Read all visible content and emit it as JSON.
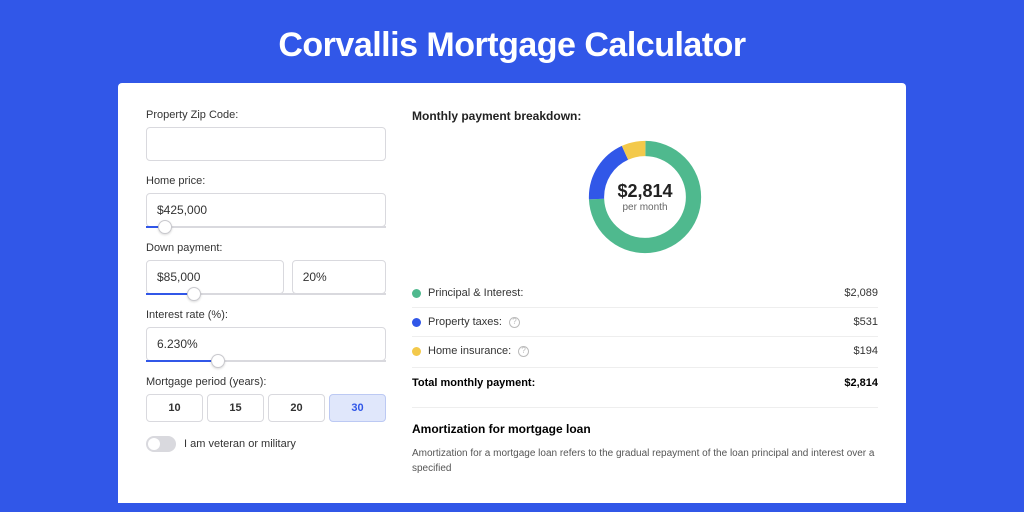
{
  "title": "Corvallis Mortgage Calculator",
  "colors": {
    "principal": "#4fb98e",
    "taxes": "#3157e8",
    "insurance": "#f3c94b"
  },
  "form": {
    "zip_label": "Property Zip Code:",
    "zip_value": "",
    "price_label": "Home price:",
    "price_value": "$425,000",
    "price_slider_pct": 8,
    "down_label": "Down payment:",
    "down_amount": "$85,000",
    "down_pct": "20%",
    "down_slider_pct": 20,
    "rate_label": "Interest rate (%):",
    "rate_value": "6.230%",
    "rate_slider_pct": 30,
    "period_label": "Mortgage period (years):",
    "periods": [
      "10",
      "15",
      "20",
      "30"
    ],
    "period_active": "30",
    "veteran_label": "I am veteran or military"
  },
  "breakdown": {
    "section_label": "Monthly payment breakdown:",
    "center_amount": "$2,814",
    "center_sub": "per month",
    "rows": [
      {
        "label": "Principal & Interest:",
        "value": "$2,089",
        "color": "principal",
        "info": false
      },
      {
        "label": "Property taxes:",
        "value": "$531",
        "color": "taxes",
        "info": true
      },
      {
        "label": "Home insurance:",
        "value": "$194",
        "color": "insurance",
        "info": true
      }
    ],
    "total_label": "Total monthly payment:",
    "total_value": "$2,814"
  },
  "chart_data": {
    "type": "pie",
    "title": "Monthly payment breakdown",
    "series": [
      {
        "name": "Principal & Interest",
        "value": 2089
      },
      {
        "name": "Property taxes",
        "value": 531
      },
      {
        "name": "Home insurance",
        "value": 194
      }
    ],
    "total": 2814,
    "unit": "USD per month"
  },
  "amortization": {
    "title": "Amortization for mortgage loan",
    "text": "Amortization for a mortgage loan refers to the gradual repayment of the loan principal and interest over a specified"
  }
}
